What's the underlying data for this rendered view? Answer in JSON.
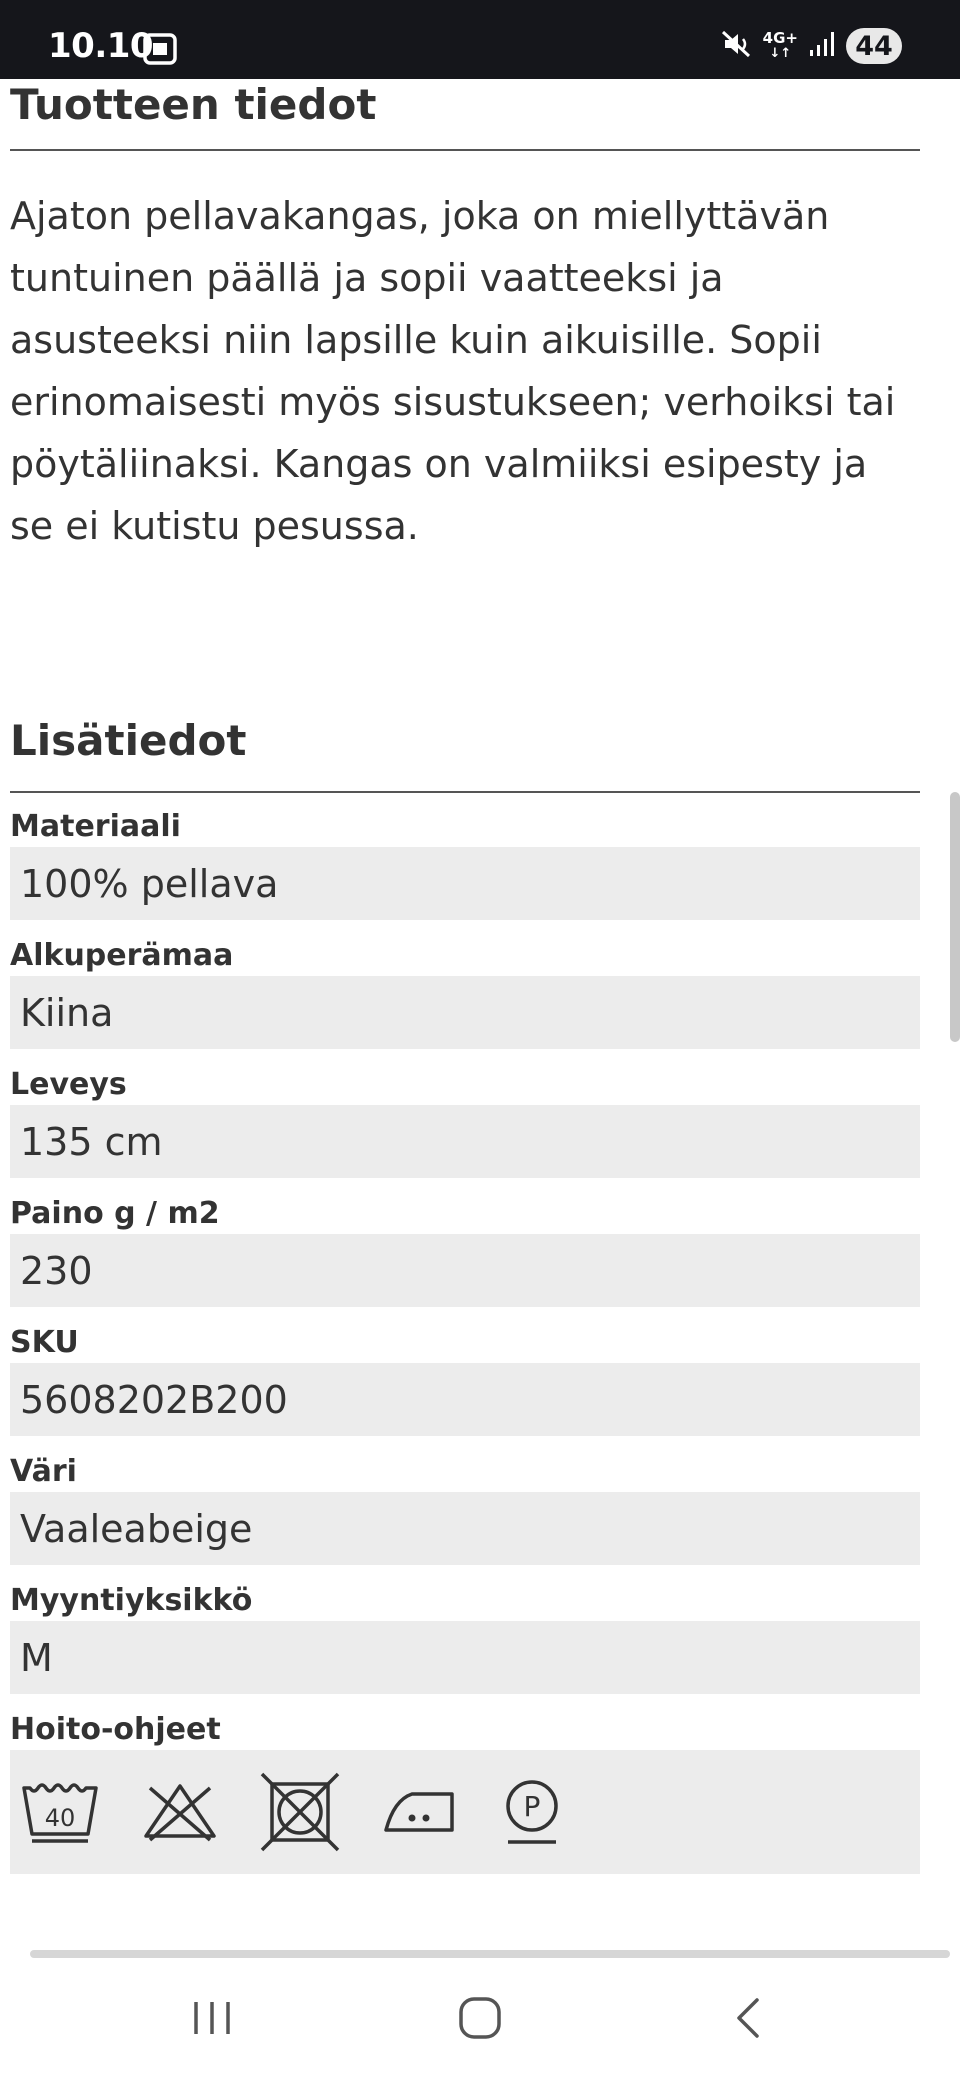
{
  "status_bar": {
    "time": "10.10",
    "network": "4G+",
    "battery": "44",
    "icons": [
      "screenshot-icon",
      "mute-icon",
      "signal-icon"
    ]
  },
  "product_info": {
    "title": "Tuotteen tiedot",
    "description": "Ajaton pellavakangas, joka on miellyttävän tuntuinen päällä ja sopii vaatteeksi ja asusteeksi niin lapsille kuin aikuisille. Sopii erinomaisesti myös sisustukseen; verhoiksi tai pöytäliinaksi. Kangas on valmiiksi esipesty ja se ei kutistu pesussa."
  },
  "additional_info": {
    "title": "Lisätiedot",
    "attributes": [
      {
        "label": "Materiaali",
        "value": "100% pellava"
      },
      {
        "label": "Alkuperämaa",
        "value": "Kiina"
      },
      {
        "label": "Leveys",
        "value": "135 cm"
      },
      {
        "label": "Paino g / m2",
        "value": "230"
      },
      {
        "label": "SKU",
        "value": "5608202B200"
      },
      {
        "label": "Väri",
        "value": "Vaaleabeige"
      },
      {
        "label": "Myyntiyksikkö",
        "value": "M"
      }
    ],
    "care_label": "Hoito-ohjeet",
    "care_wash_temp": "40",
    "care_dryclean_letter": "P",
    "care_icons": [
      "wash-40-icon",
      "no-bleach-icon",
      "no-tumble-dry-icon",
      "iron-medium-icon",
      "dry-clean-p-icon"
    ]
  },
  "nav_bar": {
    "icons": [
      "recent-apps-icon",
      "home-icon",
      "back-icon"
    ]
  }
}
